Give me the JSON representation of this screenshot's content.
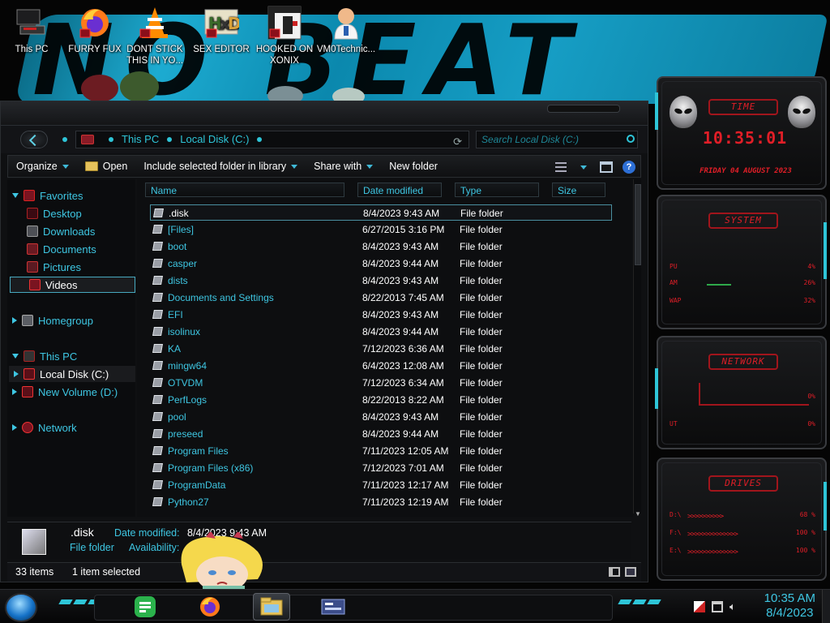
{
  "desktop": {
    "icons": [
      {
        "label": "This PC",
        "icon": "computer-icon"
      },
      {
        "label": "FURRY FUX",
        "icon": "firefox-icon"
      },
      {
        "label": "DONT STICK THIS IN YO...",
        "icon": "vlc-icon"
      },
      {
        "label": "SEX EDITOR",
        "icon": "hex-editor-icon"
      },
      {
        "label": "HOOKED ON XONIX",
        "icon": "xonix-game-icon"
      },
      {
        "label": "VM0Technic...",
        "icon": "doctor-icon"
      }
    ],
    "wallpaper_text": "NO BEAT"
  },
  "explorer": {
    "breadcrumb": [
      "This PC",
      "Local Disk (C:)"
    ],
    "search_placeholder": "Search Local Disk (C:)",
    "toolbar": {
      "organize": "Organize",
      "open": "Open",
      "include": "Include selected folder in library",
      "share": "Share with",
      "new_folder": "New folder"
    },
    "nav": {
      "favorites": "Favorites",
      "desktop": "Desktop",
      "downloads": "Downloads",
      "documents": "Documents",
      "pictures": "Pictures",
      "videos": "Videos",
      "homegroup": "Homegroup",
      "this_pc": "This PC",
      "local_disk": "Local Disk (C:)",
      "new_volume": "New Volume (D:)",
      "network": "Network"
    },
    "columns": {
      "name": "Name",
      "date": "Date modified",
      "type": "Type",
      "size": "Size"
    },
    "files": [
      {
        "name": ".disk",
        "date": "8/4/2023 9:43 AM",
        "type": "File folder"
      },
      {
        "name": "[Files]",
        "date": "6/27/2015 3:16 PM",
        "type": "File folder"
      },
      {
        "name": "boot",
        "date": "8/4/2023 9:43 AM",
        "type": "File folder"
      },
      {
        "name": "casper",
        "date": "8/4/2023 9:44 AM",
        "type": "File folder"
      },
      {
        "name": "dists",
        "date": "8/4/2023 9:43 AM",
        "type": "File folder"
      },
      {
        "name": "Documents and Settings",
        "date": "8/22/2013 7:45 AM",
        "type": "File folder"
      },
      {
        "name": "EFI",
        "date": "8/4/2023 9:43 AM",
        "type": "File folder"
      },
      {
        "name": "isolinux",
        "date": "8/4/2023 9:44 AM",
        "type": "File folder"
      },
      {
        "name": "KA",
        "date": "7/12/2023 6:36 AM",
        "type": "File folder"
      },
      {
        "name": "mingw64",
        "date": "6/4/2023 12:08 AM",
        "type": "File folder"
      },
      {
        "name": "OTVDM",
        "date": "7/12/2023 6:34 AM",
        "type": "File folder"
      },
      {
        "name": "PerfLogs",
        "date": "8/22/2013 8:22 AM",
        "type": "File folder"
      },
      {
        "name": "pool",
        "date": "8/4/2023 9:43 AM",
        "type": "File folder"
      },
      {
        "name": "preseed",
        "date": "8/4/2023 9:44 AM",
        "type": "File folder"
      },
      {
        "name": "Program Files",
        "date": "7/11/2023 12:05 AM",
        "type": "File folder"
      },
      {
        "name": "Program Files (x86)",
        "date": "7/12/2023 7:01 AM",
        "type": "File folder"
      },
      {
        "name": "ProgramData",
        "date": "7/11/2023 12:17 AM",
        "type": "File folder"
      },
      {
        "name": "Python27",
        "date": "7/11/2023 12:19 AM",
        "type": "File folder"
      }
    ],
    "details": {
      "name": ".disk",
      "type": "File folder",
      "date_label": "Date modified:",
      "date_value": "8/4/2023 9:43 AM",
      "availability_label": "Availability:"
    },
    "status": {
      "items": "33 items",
      "selected": "1 item selected"
    }
  },
  "gadgets": {
    "time": {
      "title": "TIME",
      "clock": "10:35:01",
      "date": "FRIDAY 04 AUGUST 2023"
    },
    "system": {
      "title": "SYSTEM",
      "rows": [
        {
          "label": "PU",
          "pct": "4%"
        },
        {
          "label": "AM",
          "pct": "26%"
        },
        {
          "label": "WAP",
          "pct": "32%"
        }
      ]
    },
    "network": {
      "title": "NETWORK",
      "rows": [
        {
          "label": "",
          "pct": "0%"
        },
        {
          "label": "UT",
          "pct": "0%"
        }
      ]
    },
    "drives": {
      "title": "DRIVES",
      "rows": [
        {
          "label": "D:\\",
          "pct": "68 %"
        },
        {
          "label": "F:\\",
          "pct": "100 %"
        },
        {
          "label": "E:\\",
          "pct": "100 %"
        }
      ]
    }
  },
  "taskbar": {
    "time": "10:35 AM",
    "date": "8/4/2023"
  },
  "colors": {
    "accent": "#2ec5d8",
    "gadget_red": "#e01e27",
    "window_bg": "#0f1012"
  }
}
